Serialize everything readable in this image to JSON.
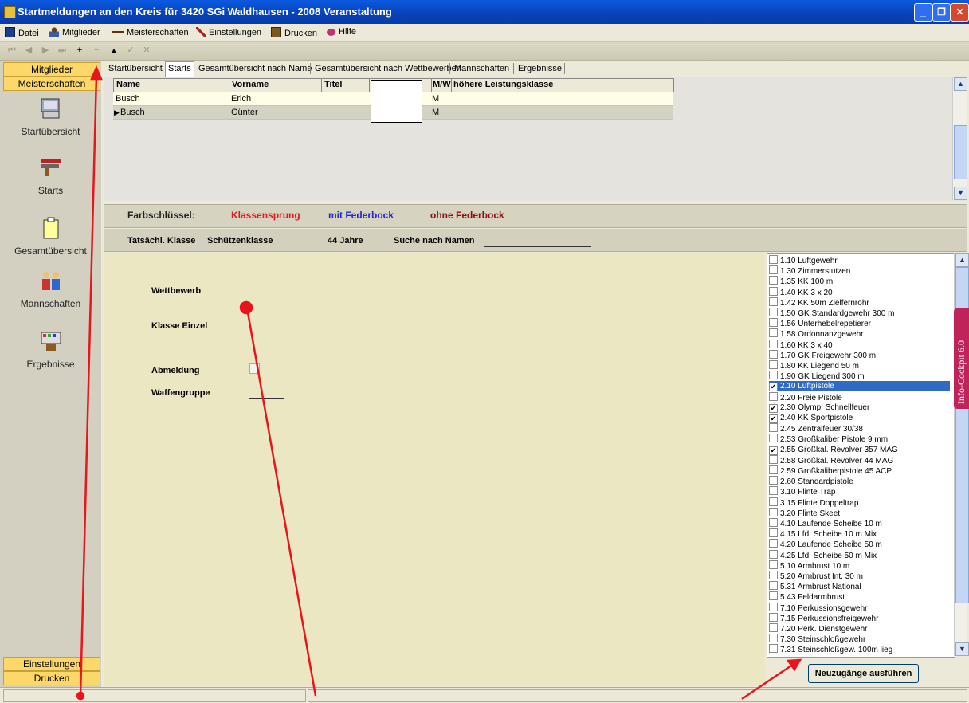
{
  "window": {
    "title": "Startmeldungen an den Kreis für 3420 SGi Waldhausen - 2008   Veranstaltung",
    "controls": [
      "minimize",
      "maximize",
      "close"
    ]
  },
  "menu": {
    "items": [
      {
        "label": "Datei",
        "icon": "save-icon"
      },
      {
        "label": "Mitglieder",
        "icon": "person-icon"
      },
      {
        "label": "Meisterschaften",
        "icon": "rifle-icon"
      },
      {
        "label": "Einstellungen",
        "icon": "tools-icon"
      },
      {
        "label": "Drucken",
        "icon": "printer-icon"
      },
      {
        "label": "Hilfe",
        "icon": "help-icon"
      }
    ]
  },
  "navbar": {
    "buttons": [
      {
        "glyph": "⏮",
        "name": "first-record"
      },
      {
        "glyph": "◀",
        "name": "prior-record"
      },
      {
        "glyph": "▶",
        "name": "next-record"
      },
      {
        "glyph": "⏭",
        "name": "last-record"
      },
      {
        "glyph": "+",
        "name": "insert-record"
      },
      {
        "glyph": "−",
        "name": "delete-record"
      },
      {
        "glyph": "▲",
        "name": "edit-record"
      },
      {
        "glyph": "✓",
        "name": "post-record"
      },
      {
        "glyph": "✕",
        "name": "cancel-record"
      }
    ]
  },
  "sidebar": {
    "top_buttons": [
      "Mitglieder",
      "Meisterschaften"
    ],
    "items": [
      {
        "label": "Startübersicht",
        "icon": "overview-icon"
      },
      {
        "label": "Starts",
        "icon": "pistol-icon"
      },
      {
        "label": "Gesamtübersicht",
        "icon": "clipboard-icon"
      },
      {
        "label": "Mannschaften",
        "icon": "team-icon"
      },
      {
        "label": "Ergebnisse",
        "icon": "scoreboard-icon"
      }
    ],
    "bottom_buttons": [
      "Einstellungen",
      "Drucken"
    ]
  },
  "tabs": [
    {
      "label": "Startübersicht",
      "active": false
    },
    {
      "label": "Starts",
      "active": true
    },
    {
      "label": "Gesamtübersicht nach Name",
      "active": false
    },
    {
      "label": "Gesamtübersicht nach Wettbewerben",
      "active": false
    },
    {
      "label": "Mannschaften",
      "active": false
    },
    {
      "label": "Ergebnisse",
      "active": false
    }
  ],
  "grid": {
    "columns": [
      "Name",
      "Vorname",
      "Titel",
      "",
      "M/W",
      "höhere Leistungsklasse"
    ],
    "rows": [
      {
        "name": "Busch",
        "vorname": "Erich",
        "mw": "M",
        "current": false
      },
      {
        "name": "Busch",
        "vorname": "Günter",
        "mw": "M",
        "current": true
      }
    ]
  },
  "legend": {
    "label": "Farbschlüssel:",
    "items": [
      {
        "label": "Klassensprung",
        "color": "#e8161c"
      },
      {
        "label": "mit Federbock",
        "color": "#2424d8"
      },
      {
        "label": "ohne Federbock",
        "color": "#8a1010"
      }
    ]
  },
  "infobar": {
    "klasse_label": "Tatsächl. Klasse",
    "klasse_value": "Schützenklasse",
    "age": "44 Jahre",
    "search_label": "Suche nach Namen"
  },
  "form": {
    "wettbewerb": "Wettbewerb",
    "klasse_einzel": "Klasse Einzel",
    "abmeldung": "Abmeldung",
    "waffengruppe": "Waffengruppe"
  },
  "competitions": [
    {
      "label": "1.10 Luftgewehr",
      "checked": false
    },
    {
      "label": "1.30 Zimmerstutzen",
      "checked": false
    },
    {
      "label": "1.35 KK 100 m",
      "checked": false
    },
    {
      "label": "1.40 KK 3 x 20",
      "checked": false
    },
    {
      "label": "1.42 KK 50m Zielfernrohr",
      "checked": false
    },
    {
      "label": "1.50 GK Standardgewehr 300 m",
      "checked": false
    },
    {
      "label": "1.56 Unterhebelrepetierer",
      "checked": false
    },
    {
      "label": "1.58 Ordonnanzgewehr",
      "checked": false
    },
    {
      "label": "1.60 KK 3 x 40",
      "checked": false
    },
    {
      "label": "1.70 GK Freigewehr 300 m",
      "checked": false
    },
    {
      "label": "1.80 KK Liegend 50 m",
      "checked": false
    },
    {
      "label": "1.90 GK Liegend 300 m",
      "checked": false
    },
    {
      "label": "2.10 Luftpistole",
      "checked": true,
      "selected": true
    },
    {
      "label": "2.20 Freie Pistole",
      "checked": false
    },
    {
      "label": "2.30 Olymp. Schnellfeuer",
      "checked": true
    },
    {
      "label": "2.40 KK Sportpistole",
      "checked": true
    },
    {
      "label": "2.45 Zentralfeuer 30/38",
      "checked": false
    },
    {
      "label": "2.53 Großkaliber Pistole 9 mm",
      "checked": false
    },
    {
      "label": "2.55 Großkal. Revolver 357 MAG",
      "checked": true
    },
    {
      "label": "2.58 Großkal. Revolver 44 MAG",
      "checked": false
    },
    {
      "label": "2.59 Großkaliberpistole 45 ACP",
      "checked": false
    },
    {
      "label": "2.60 Standardpistole",
      "checked": false
    },
    {
      "label": "3.10 Flinte Trap",
      "checked": false
    },
    {
      "label": "3.15 Flinte Doppeltrap",
      "checked": false
    },
    {
      "label": "3.20 Flinte Skeet",
      "checked": false
    },
    {
      "label": "4.10 Laufende Scheibe 10 m",
      "checked": false
    },
    {
      "label": "4.15 Lfd. Scheibe 10 m Mix",
      "checked": false
    },
    {
      "label": "4.20 Laufende Scheibe 50 m",
      "checked": false
    },
    {
      "label": "4.25 Lfd. Scheibe 50 m Mix",
      "checked": false
    },
    {
      "label": "5.10 Armbrust 10 m",
      "checked": false
    },
    {
      "label": "5.20 Armbrust Int. 30 m",
      "checked": false
    },
    {
      "label": "5.31 Armbrust National",
      "checked": false
    },
    {
      "label": "5.43 Feldarmbrust",
      "checked": false
    },
    {
      "label": "7.10 Perkussionsgewehr",
      "checked": false
    },
    {
      "label": "7.15 Perkussionsfreigewehr",
      "checked": false
    },
    {
      "label": "7.20 Perk. Dienstgewehr",
      "checked": false
    },
    {
      "label": "7.30 Steinschloßgewehr",
      "checked": false
    },
    {
      "label": "7.31 Steinschloßgew. 100m lieg",
      "checked": false
    }
  ],
  "actions": {
    "execute": "Neuzugänge ausführen"
  },
  "cockpit": {
    "label": "Info-Cockpit 6.0"
  },
  "colors": {
    "title_bar": "#0a4fd4",
    "sidebar_button": "#fcd76a",
    "selection": "#316ac5",
    "annotation": "#e8161c",
    "cockpit_tab": "#c0235a"
  }
}
